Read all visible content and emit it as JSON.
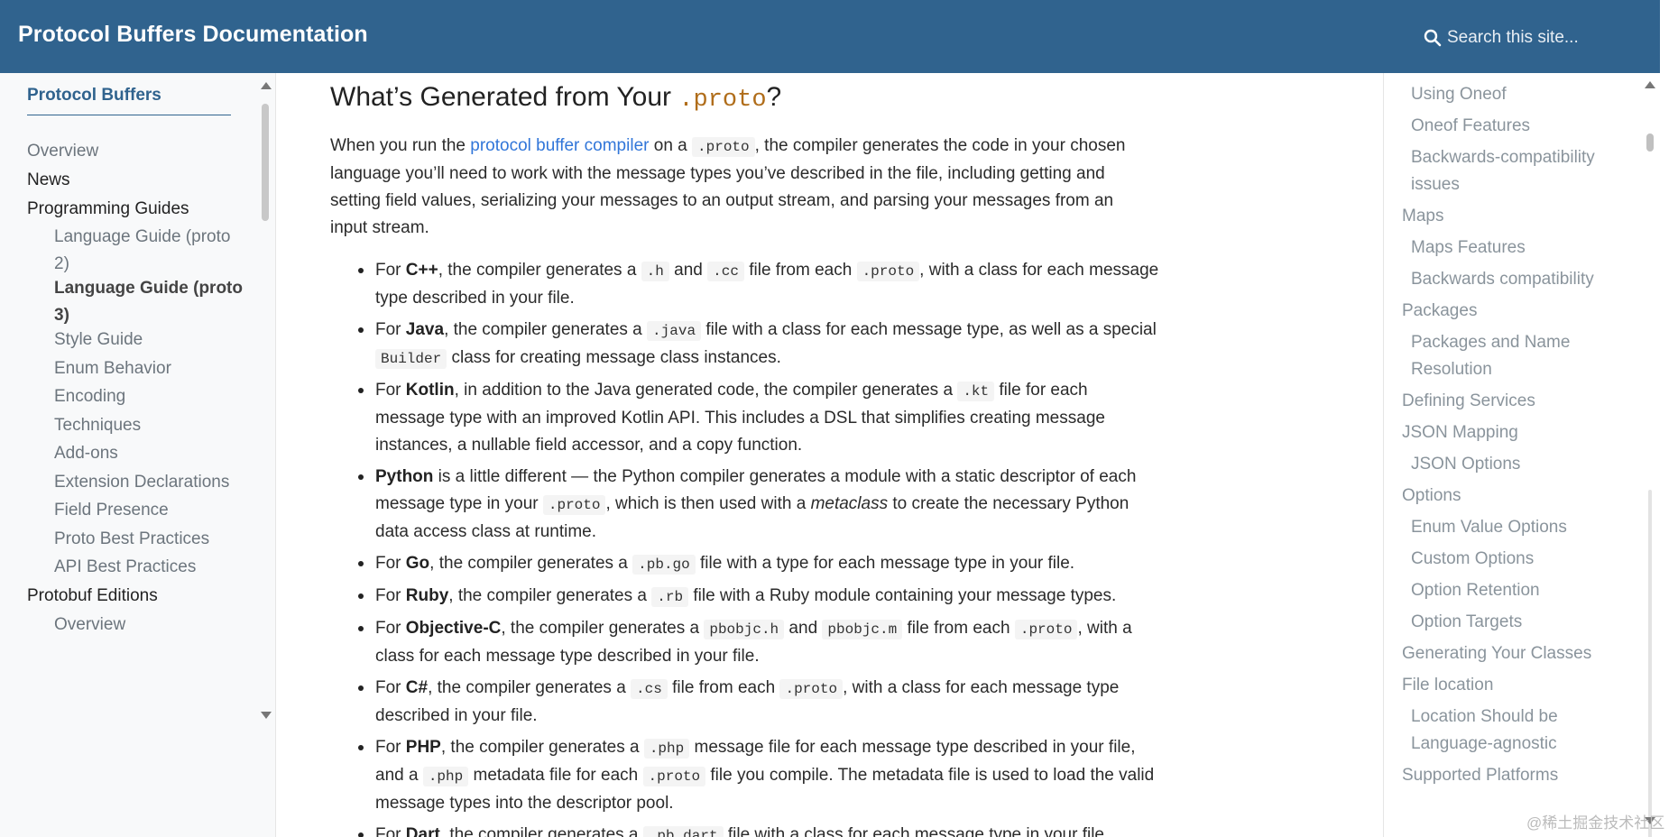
{
  "header": {
    "brand": "Protocol Buffers Documentation",
    "search_placeholder": "Search this site..."
  },
  "sidebar": {
    "root": "Protocol Buffers",
    "items": [
      {
        "label": "Overview"
      },
      {
        "label": "News"
      },
      {
        "label": "Programming Guides"
      },
      {
        "label": "Language Guide (proto 2)"
      },
      {
        "label": "Language Guide (proto 3)"
      },
      {
        "label": "Style Guide"
      },
      {
        "label": "Enum Behavior"
      },
      {
        "label": "Encoding"
      },
      {
        "label": "Techniques"
      },
      {
        "label": "Add-ons"
      },
      {
        "label": "Extension Declarations"
      },
      {
        "label": "Field Presence"
      },
      {
        "label": "Proto Best Practices"
      },
      {
        "label": "API Best Practices"
      },
      {
        "label": "Protobuf Editions"
      },
      {
        "label": "Overview"
      }
    ]
  },
  "main": {
    "heading_pre": "What’s Generated from Your ",
    "heading_code": ".proto",
    "heading_post": "?",
    "para": {
      "t1": "When you run the ",
      "link": "protocol buffer compiler",
      "t2": " on a ",
      "c1": ".proto",
      "t3": ", the compiler generates the code in your chosen language you’ll need to work with the message types you’ve described in the file, including getting and setting field values, serializing your messages to an output stream, and parsing your messages from an input stream."
    },
    "bullets": {
      "cpp": {
        "t1": "For ",
        "b": "C++",
        "t2": ", the compiler generates a ",
        "c1": ".h",
        "t3": " and ",
        "c2": ".cc",
        "t4": " file from each ",
        "c3": ".proto",
        "t5": ", with a class for each message type described in your file."
      },
      "java": {
        "t1": "For ",
        "b": "Java",
        "t2": ", the compiler generates a ",
        "c1": ".java",
        "t3": " file with a class for each message type, as well as a special ",
        "c2": "Builder",
        "t4": " class for creating message class instances."
      },
      "kotlin": {
        "t1": "For ",
        "b": "Kotlin",
        "t2": ", in addition to the Java generated code, the compiler generates a ",
        "c1": ".kt",
        "t3": " file for each message type with an improved Kotlin API. This includes a DSL that simplifies creating message instances, a nullable field accessor, and a copy function."
      },
      "python": {
        "b": "Python",
        "t1": " is a little different — the Python compiler generates a module with a static descriptor of each message type in your ",
        "c1": ".proto",
        "t2": ", which is then used with a ",
        "i": "metaclass",
        "t3": " to create the necessary Python data access class at runtime."
      },
      "go": {
        "t1": "For ",
        "b": "Go",
        "t2": ", the compiler generates a ",
        "c1": ".pb.go",
        "t3": " file with a type for each message type in your file."
      },
      "ruby": {
        "t1": "For ",
        "b": "Ruby",
        "t2": ", the compiler generates a ",
        "c1": ".rb",
        "t3": " file with a Ruby module containing your message types."
      },
      "objc": {
        "t1": "For ",
        "b": "Objective-C",
        "t2": ", the compiler generates a ",
        "c1": "pbobjc.h",
        "t3": " and ",
        "c2": "pbobjc.m",
        "t4": " file from each ",
        "c3": ".proto",
        "t5": ", with a class for each message type described in your file."
      },
      "csharp": {
        "t1": "For ",
        "b": "C#",
        "t2": ", the compiler generates a ",
        "c1": ".cs",
        "t3": " file from each ",
        "c2": ".proto",
        "t4": ", with a class for each message type described in your file."
      },
      "php": {
        "t1": "For ",
        "b": "PHP",
        "t2": ", the compiler generates a ",
        "c1": ".php",
        "t3": " message file for each message type described in your file, and a ",
        "c2": ".php",
        "t4": " metadata file for each ",
        "c3": ".proto",
        "t5": " file you compile. The metadata file is used to load the valid message types into the descriptor pool."
      },
      "dart": {
        "t1": "For ",
        "b": "Dart",
        "t2": ", the compiler generates a ",
        "c1": ".pb.dart",
        "t3": " file with a class for each message type in your file."
      }
    }
  },
  "toc": {
    "items": [
      {
        "label": "Using Oneof"
      },
      {
        "label": "Oneof Features"
      },
      {
        "label": "Backwards-compatibility"
      },
      {
        "label": "issues"
      },
      {
        "label": "Maps"
      },
      {
        "label": "Maps Features"
      },
      {
        "label": "Backwards compatibility"
      },
      {
        "label": "Packages"
      },
      {
        "label": "Packages and Name"
      },
      {
        "label": "Resolution"
      },
      {
        "label": "Defining Services"
      },
      {
        "label": "JSON Mapping"
      },
      {
        "label": "JSON Options"
      },
      {
        "label": "Options"
      },
      {
        "label": "Enum Value Options"
      },
      {
        "label": "Custom Options"
      },
      {
        "label": "Option Retention"
      },
      {
        "label": "Option Targets"
      },
      {
        "label": "Generating Your Classes"
      },
      {
        "label": "File location"
      },
      {
        "label": "Location Should be"
      },
      {
        "label": "Language-agnostic"
      },
      {
        "label": "Supported Platforms"
      }
    ]
  },
  "watermark": "@稀土掘金技术社区",
  "colors": {
    "header_bg": "#30638e",
    "link": "#3176d9",
    "code_accent": "#b06d1a"
  }
}
